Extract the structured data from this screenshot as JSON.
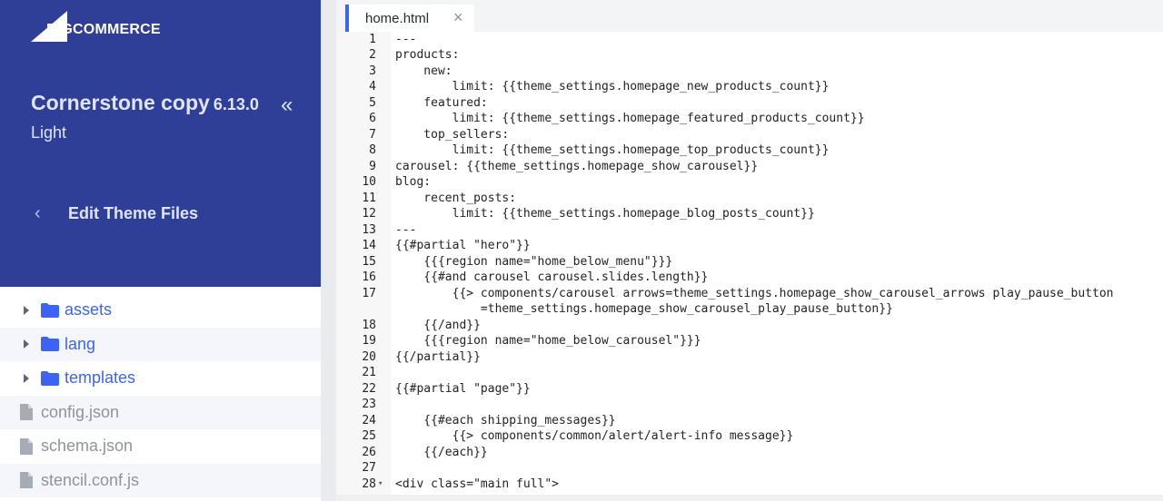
{
  "sidebar": {
    "logo_text": "BIGCOMMERCE",
    "theme_name": "Cornerstone copy",
    "theme_version": "6.13.0",
    "theme_variant": "Light",
    "collapse_icon": "double-chevron-left-icon",
    "back_label": "Edit Theme Files",
    "tree": [
      {
        "type": "folder",
        "label": "assets"
      },
      {
        "type": "folder",
        "label": "lang"
      },
      {
        "type": "folder",
        "label": "templates"
      },
      {
        "type": "file",
        "label": "config.json"
      },
      {
        "type": "file",
        "label": "schema.json"
      },
      {
        "type": "file",
        "label": "stencil.conf.js"
      }
    ]
  },
  "editor": {
    "tab_label": "home.html",
    "tab_close": "×",
    "lines": [
      {
        "n": "1",
        "t": "---"
      },
      {
        "n": "2",
        "t": "products:"
      },
      {
        "n": "3",
        "t": "    new:"
      },
      {
        "n": "4",
        "t": "        limit: {{theme_settings.homepage_new_products_count}}"
      },
      {
        "n": "5",
        "t": "    featured:"
      },
      {
        "n": "6",
        "t": "        limit: {{theme_settings.homepage_featured_products_count}}"
      },
      {
        "n": "7",
        "t": "    top_sellers:"
      },
      {
        "n": "8",
        "t": "        limit: {{theme_settings.homepage_top_products_count}}"
      },
      {
        "n": "9",
        "t": "carousel: {{theme_settings.homepage_show_carousel}}"
      },
      {
        "n": "10",
        "t": "blog:"
      },
      {
        "n": "11",
        "t": "    recent_posts:"
      },
      {
        "n": "12",
        "t": "        limit: {{theme_settings.homepage_blog_posts_count}}"
      },
      {
        "n": "13",
        "t": "---"
      },
      {
        "n": "14",
        "t": "{{#partial \"hero\"}}"
      },
      {
        "n": "15",
        "t": "    {{{region name=\"home_below_menu\"}}}"
      },
      {
        "n": "16",
        "t": "    {{#and carousel carousel.slides.length}}"
      },
      {
        "n": "17",
        "t": "        {{> components/carousel arrows=theme_settings.homepage_show_carousel_arrows play_pause_button"
      },
      {
        "n": "",
        "t": "            =theme_settings.homepage_show_carousel_play_pause_button}}"
      },
      {
        "n": "18",
        "t": "    {{/and}}"
      },
      {
        "n": "19",
        "t": "    {{{region name=\"home_below_carousel\"}}}"
      },
      {
        "n": "20",
        "t": "{{/partial}}"
      },
      {
        "n": "21",
        "t": ""
      },
      {
        "n": "22",
        "t": "{{#partial \"page\"}}"
      },
      {
        "n": "23",
        "t": ""
      },
      {
        "n": "24",
        "t": "    {{#each shipping_messages}}"
      },
      {
        "n": "25",
        "t": "        {{> components/common/alert/alert-info message}}"
      },
      {
        "n": "26",
        "t": "    {{/each}}"
      },
      {
        "n": "27",
        "t": ""
      },
      {
        "n": "28",
        "t": "<div class=\"main full\">"
      }
    ]
  },
  "colors": {
    "sidebar_bg": "#2f3f97",
    "accent": "#3c64f4",
    "file_gray": "#8f939b"
  }
}
